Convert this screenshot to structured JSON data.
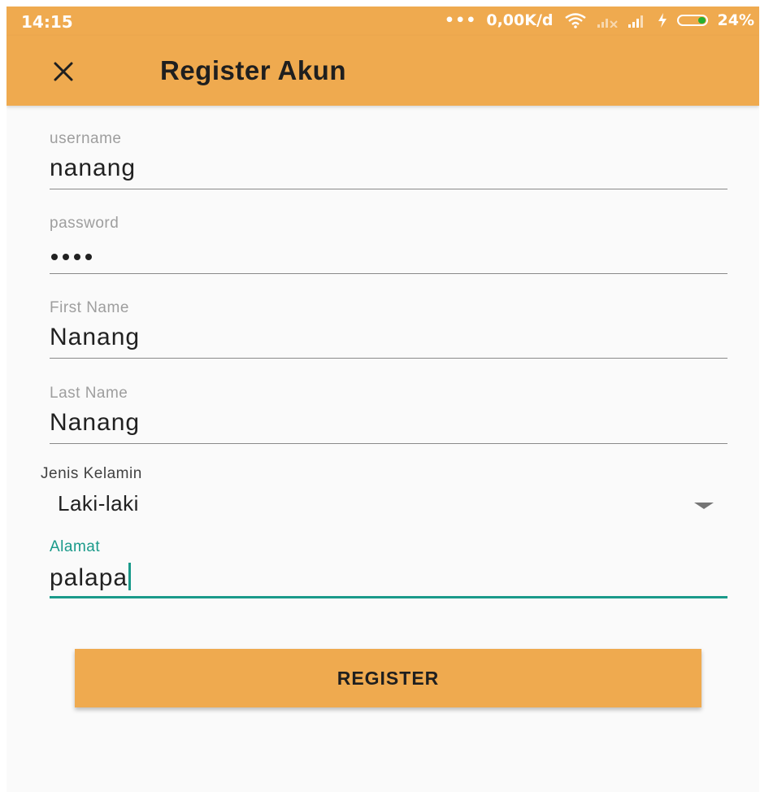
{
  "statusbar": {
    "time": "14:15",
    "network_speed": "0,00K/d",
    "battery": "24%",
    "battery_level": 0.24,
    "icons": [
      "wifi-icon",
      "signal-no-sim-icon",
      "signal-icon",
      "charging-icon",
      "battery-icon"
    ]
  },
  "appbar": {
    "title": "Register Akun",
    "close_icon": "close-icon"
  },
  "form": {
    "username": {
      "label": "username",
      "value": "nanang"
    },
    "password": {
      "label": "password",
      "masked_length": 4
    },
    "first_name": {
      "label": "First Name",
      "value": "Nanang"
    },
    "last_name": {
      "label": "Last Name",
      "value": "Nanang"
    },
    "gender": {
      "label": "Jenis Kelamin",
      "value": "Laki-laki"
    },
    "address": {
      "label": "Alamat",
      "value": "palapa"
    }
  },
  "register_button": {
    "label": "REGISTER"
  },
  "colors": {
    "primary": "#efaa4f",
    "accent": "#1a9a8a",
    "background": "#fafafa"
  }
}
